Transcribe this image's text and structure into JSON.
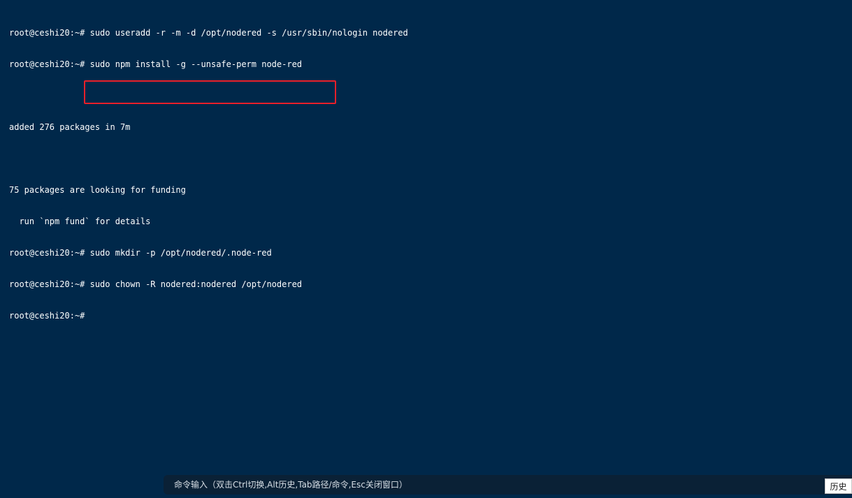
{
  "terminal": {
    "lines": [
      "root@ceshi20:~# sudo useradd -r -m -d /opt/nodered -s /usr/sbin/nologin nodered",
      "root@ceshi20:~# sudo npm install -g --unsafe-perm node-red",
      "",
      "added 276 packages in 7m",
      "",
      "75 packages are looking for funding",
      "  run `npm fund` for details",
      "root@ceshi20:~# sudo mkdir -p /opt/nodered/.node-red",
      "root@ceshi20:~# sudo chown -R nodered:nodered /opt/nodered",
      "root@ceshi20:~# "
    ],
    "highlight_color": "#e8202a",
    "background_color": "#00284a",
    "text_color": "#ffffff"
  },
  "command_input": {
    "hint": "命令输入（双击Ctrl切换,Alt历史,Tab路径/命令,Esc关闭窗口）"
  },
  "history_button": {
    "label": "历史"
  }
}
